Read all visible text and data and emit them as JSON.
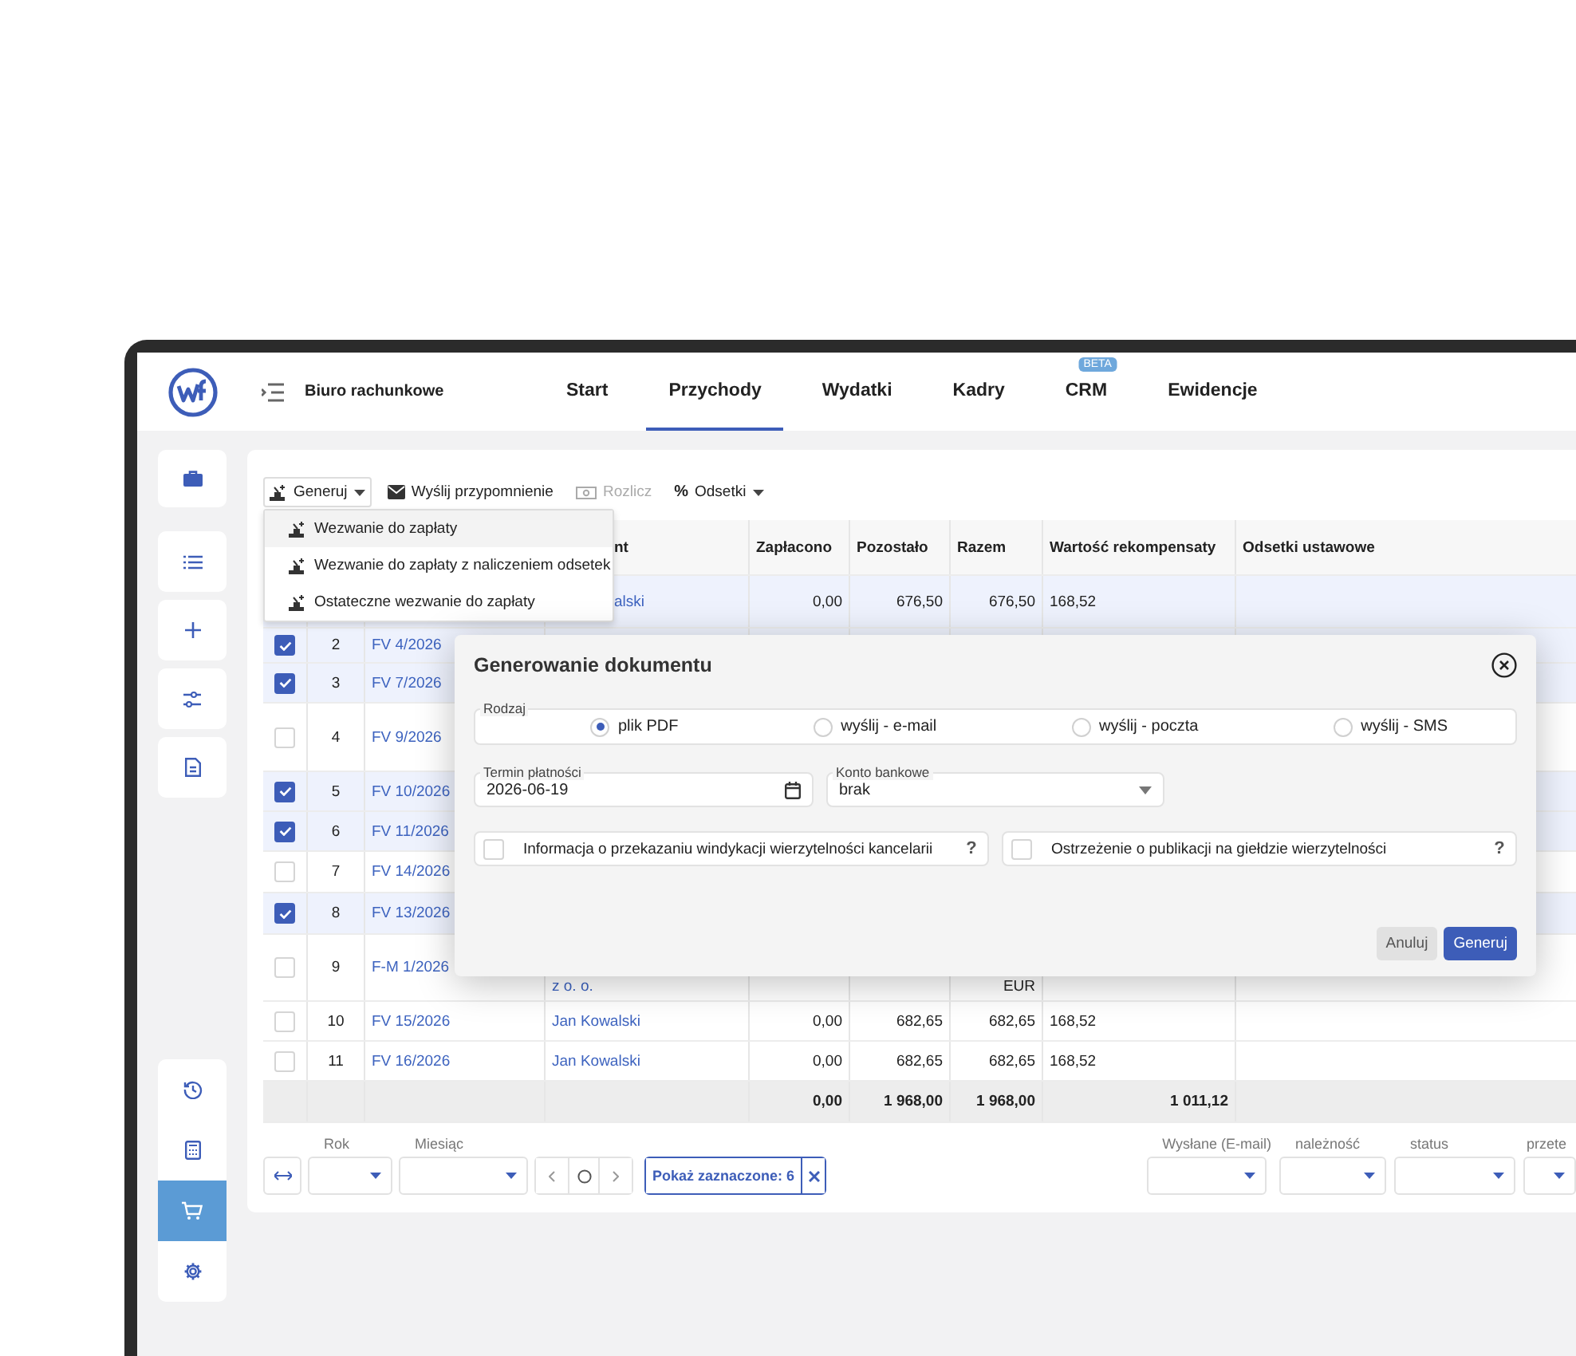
{
  "header": {
    "company": "Biuro rachunkowe",
    "tabs": [
      {
        "label": "Start",
        "selected": false
      },
      {
        "label": "Przychody",
        "selected": true
      },
      {
        "label": "Wydatki",
        "selected": false
      },
      {
        "label": "Kadry",
        "selected": false
      },
      {
        "label": "CRM",
        "selected": false,
        "badge": "BETA"
      },
      {
        "label": "Ewidencje",
        "selected": false
      }
    ]
  },
  "sidebar": {
    "top": [
      {
        "kind": "briefcase"
      }
    ],
    "middle": [
      {
        "kind": "list"
      },
      {
        "kind": "plus"
      },
      {
        "kind": "sliders"
      },
      {
        "kind": "document"
      }
    ],
    "bottom": [
      {
        "kind": "history",
        "selected": false
      },
      {
        "kind": "calculator",
        "selected": false
      },
      {
        "kind": "cart",
        "selected": true
      },
      {
        "kind": "gear",
        "selected": false
      }
    ]
  },
  "toolbar": [
    {
      "kind": "stamp",
      "label": "Generuj",
      "dropdown": true,
      "disabled": false
    },
    {
      "kind": "envelope",
      "label": "Wyślij przypomnienie",
      "dropdown": false,
      "disabled": false
    },
    {
      "kind": "banknote",
      "label": "Rozlicz",
      "dropdown": false,
      "disabled": true
    },
    {
      "kind": "percent",
      "icon": "%",
      "label": "Odsetki",
      "dropdown": true,
      "disabled": false
    }
  ],
  "dropdown": [
    {
      "label": "Wezwanie do zapłaty",
      "selected": true
    },
    {
      "label": "Wezwanie do zapłaty z naliczeniem odsetek",
      "selected": false
    },
    {
      "label": "Ostateczne wezwanie do zapłaty",
      "selected": false
    }
  ],
  "table": {
    "columns": {
      "client": "nt",
      "paid": "Zapłacono",
      "remaining": "Pozostało",
      "total": "Razem",
      "compensation": "Wartość rekompensaty",
      "interest": "Odsetki ustawowe"
    },
    "rows": [
      {
        "selected": true,
        "client": "alski",
        "paid": "0,00",
        "remaining": "676,50",
        "total": "676,50",
        "compensation": "168,52"
      },
      {
        "selected": true,
        "checked": true,
        "number": "2",
        "invoice": "FV 4/2026"
      },
      {
        "selected": true,
        "checked": true,
        "number": "3",
        "invoice": "FV 7/2026"
      },
      {
        "selected": false,
        "checked": false,
        "number": "4",
        "invoice": "FV 9/2026"
      },
      {
        "selected": true,
        "checked": true,
        "number": "5",
        "invoice": "FV 10/2026"
      },
      {
        "selected": true,
        "checked": true,
        "number": "6",
        "invoice": "FV 11/2026"
      },
      {
        "selected": false,
        "checked": false,
        "number": "7",
        "invoice": "FV 14/2026"
      },
      {
        "selected": true,
        "checked": true,
        "number": "8",
        "invoice": "FV 13/2026"
      },
      {
        "selected": false,
        "checked": false,
        "number": "9",
        "invoice": "F-M 1/2026",
        "client": "z o. o.",
        "total": "EUR"
      },
      {
        "selected": false,
        "checked": false,
        "number": "10",
        "invoice": "FV 15/2026",
        "client": "Jan Kowalski",
        "paid": "0,00",
        "remaining": "682,65",
        "total": "682,65",
        "compensation": "168,52"
      },
      {
        "selected": false,
        "checked": false,
        "number": "11",
        "invoice": "FV 16/2026",
        "client": "Jan Kowalski",
        "paid": "0,00",
        "remaining": "682,65",
        "total": "682,65",
        "compensation": "168,52"
      }
    ],
    "totals": {
      "paid": "0,00",
      "remaining": "1 968,00",
      "total": "1 968,00",
      "compensation": "1 011,12"
    }
  },
  "filters": {
    "left": [
      {
        "label": "Rok"
      },
      {
        "label": "Miesiąc"
      }
    ],
    "selected_button": "Pokaż zaznaczone: 6",
    "right": [
      {
        "label": "Wysłane (E-mail)"
      },
      {
        "label": "należność"
      },
      {
        "label": "status"
      },
      {
        "label": "przete"
      }
    ]
  },
  "modal": {
    "title": "Generowanie dokumentu",
    "kind_legend": "Rodzaj",
    "options": [
      {
        "label": "plik PDF",
        "selected": true
      },
      {
        "label": "wyślij - e-mail",
        "selected": false
      },
      {
        "label": "wyślij - poczta",
        "selected": false
      },
      {
        "label": "wyślij - SMS",
        "selected": false
      }
    ],
    "due_label": "Termin płatności",
    "due_value": "2026-06-19",
    "bank_label": "Konto bankowe",
    "bank_value": "brak",
    "checks": [
      {
        "label": "Informacja o przekazaniu windykacji wierzytelności kancelarii",
        "checked": false,
        "help": "?"
      },
      {
        "label": "Ostrzeżenie o publikacji na giełdzie wierzytelności",
        "checked": false,
        "help": "?"
      }
    ],
    "buttons": [
      {
        "label": "Anuluj",
        "kind": "secondary"
      },
      {
        "label": "Generuj",
        "kind": "primary"
      }
    ]
  }
}
